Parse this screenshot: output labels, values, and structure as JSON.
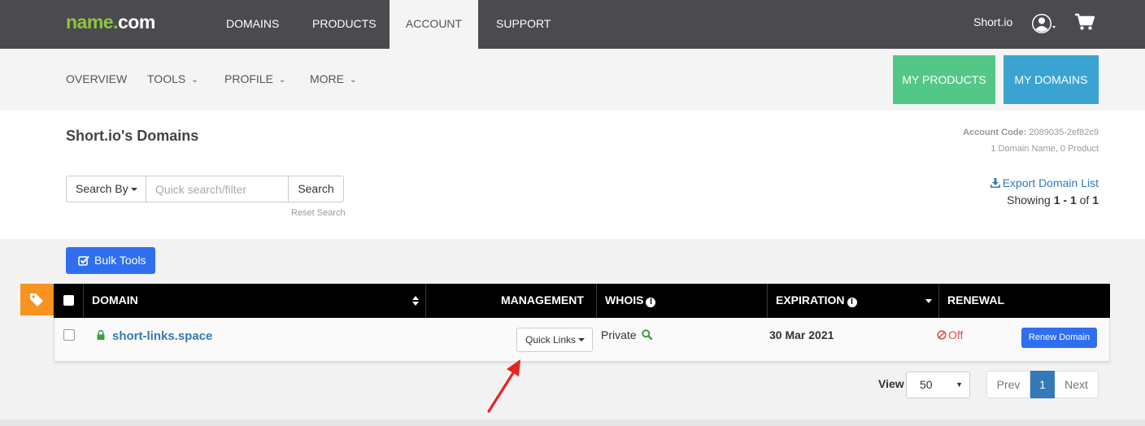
{
  "topbar": {
    "logo": {
      "name": "name",
      "dot": ".",
      "com": "com"
    },
    "nav": [
      {
        "label": "DOMAINS"
      },
      {
        "label": "PRODUCTS"
      },
      {
        "label": "ACCOUNT"
      },
      {
        "label": "SUPPORT"
      }
    ],
    "active_nav": "ACCOUNT",
    "user": "Short.io",
    "icons": [
      "user-avatar-icon",
      "cart-icon"
    ]
  },
  "subnav": {
    "items": [
      {
        "label": "OVERVIEW"
      },
      {
        "label": "TOOLS"
      },
      {
        "label": "PROFILE"
      },
      {
        "label": "MORE"
      }
    ],
    "my_products": "MY PRODUCTS",
    "my_domains": "MY DOMAINS"
  },
  "header": {
    "title": "Short.io's Domains",
    "account_code_label": "Account Code:",
    "account_code": "2089035-2ef82c9",
    "summary": "1 Domain Name, 0 Product",
    "export": "Export Domain List",
    "showing_prefix": "Showing",
    "showing_range": "1 - 1",
    "showing_of": "of",
    "showing_total": "1"
  },
  "search": {
    "search_by": "Search By",
    "placeholder": "Quick search/filter",
    "value": "",
    "button": "Search",
    "reset": "Reset Search"
  },
  "bulk_tools": "Bulk Tools",
  "table": {
    "headers": {
      "domain": "DOMAIN",
      "management": "MANAGEMENT",
      "whois": "WHOIS",
      "expiration": "EXPIRATION",
      "renewal": "RENEWAL"
    },
    "rows": [
      {
        "domain": "short-links.space",
        "management": "Quick Links",
        "whois": "Private",
        "expiration": "30 Mar 2021",
        "renewal": "Off",
        "renew_button": "Renew Domain"
      }
    ]
  },
  "pagination": {
    "view_label": "View",
    "per_page": "50",
    "prev": "Prev",
    "current": "1",
    "next": "Next"
  },
  "colors": {
    "topbar": "#4a4a4f",
    "logo_green": "#8cc63f",
    "my_products": "#53c785",
    "my_domains": "#3aa3d1",
    "primary_button": "#2f6fef",
    "link": "#337ab7",
    "tag": "#f7931e",
    "off": "#d9534f",
    "annotation_arrow": "#e8231f"
  }
}
